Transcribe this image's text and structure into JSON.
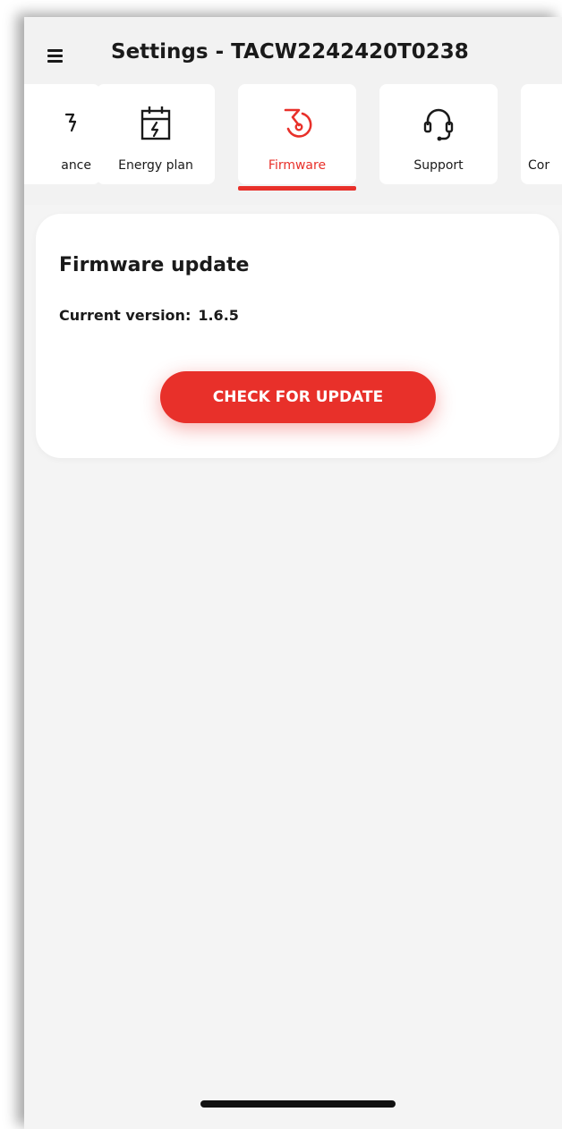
{
  "header": {
    "title": "Settings - TACW2242420T0238",
    "menu_icon": "hamburger-menu-icon"
  },
  "tabs": [
    {
      "label": "ance",
      "icon": "maintenance-icon",
      "active": false
    },
    {
      "label": "Energy plan",
      "icon": "calendar-bolt-icon",
      "active": false
    },
    {
      "label": "Firmware",
      "icon": "firmware-update-icon",
      "active": true
    },
    {
      "label": "Support",
      "icon": "headset-icon",
      "active": false
    },
    {
      "label": "Cor",
      "icon": "",
      "active": false
    }
  ],
  "firmware": {
    "title": "Firmware update",
    "version_label": "Current version:",
    "version_value": "1.6.5",
    "check_button": "CHECK FOR UPDATE"
  },
  "colors": {
    "accent": "#e8302a",
    "background": "#f4f4f4",
    "card": "#ffffff",
    "text": "#1a1a1a"
  }
}
